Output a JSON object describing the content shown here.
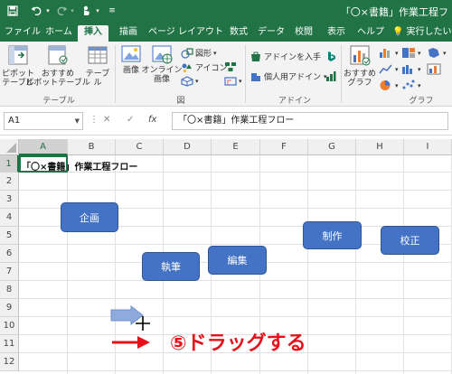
{
  "window": {
    "title": "「〇×書籍」作業工程フ"
  },
  "tabs": [
    "ファイル",
    "ホーム",
    "挿入",
    "描画",
    "ページ レイアウト",
    "数式",
    "データ",
    "校閲",
    "表示",
    "ヘルプ",
    "実行したい"
  ],
  "ribbon": {
    "pivot": "ピボット\nテーブル",
    "rec_pivot": "おすすめ\nピボットテーブル",
    "table": "テーブル",
    "group_table": "テーブル",
    "image": "画像",
    "online_image": "オンライン\n画像",
    "shapes": "図形",
    "icons": "アイコン",
    "group_fig": "図",
    "get_addin": "アドインを入手",
    "personal_addin": "個人用アドイン",
    "group_addin": "アドイン",
    "rec_chart": "おすすめ\nグラフ",
    "group_graph": "グラフ"
  },
  "formula_bar": {
    "name_box": "A1",
    "cancel": "✕",
    "enter": "✓",
    "fx": "fx",
    "formula": "「〇×書籍」作業工程フロー"
  },
  "grid": {
    "columns": [
      "A",
      "B",
      "C",
      "D",
      "E",
      "F",
      "G",
      "H",
      "I"
    ],
    "rows": [
      "1",
      "2",
      "3",
      "4",
      "5",
      "6",
      "7",
      "8",
      "9",
      "10",
      "11",
      "12"
    ],
    "a1_value": "「〇×書籍」作業工程フロー"
  },
  "shapes": [
    "企画",
    "執筆",
    "編集",
    "制作",
    "校正"
  ],
  "annotation": "⑤ドラッグする",
  "colors": {
    "excel_green": "#217346",
    "shape_blue": "#4472c4",
    "annotation_red": "#e6101b"
  }
}
